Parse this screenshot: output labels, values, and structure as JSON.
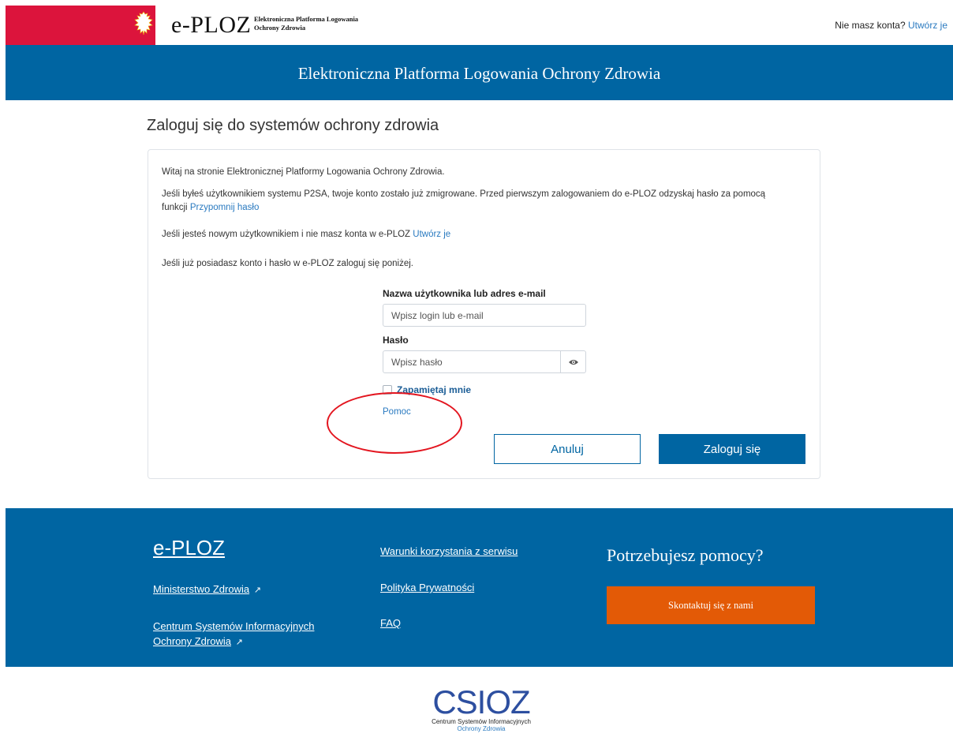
{
  "header": {
    "logo_text": "e-PLOZ",
    "logo_sub_line1": "Elektroniczna Platforma Logowania",
    "logo_sub_line2": "Ochrony Zdrowia",
    "no_account_text": "Nie masz konta?",
    "create_link": "Utwórz je"
  },
  "hero": {
    "title": "Elektroniczna Platforma Logowania Ochrony Zdrowia"
  },
  "page": {
    "title": "Zaloguj się do systemów ochrony zdrowia"
  },
  "card": {
    "welcome": "Witaj na stronie Elektronicznej Platformy Logowania Ochrony Zdrowia.",
    "migrated_text": "Jeśli byłeś użytkownikiem systemu P2SA, twoje konto zostało już zmigrowane. Przed pierwszym zalogowaniem do e-PLOZ odzyskaj hasło za pomocą",
    "migrated_text2": "funkcji",
    "reset_link": "Przypomnij hasło",
    "new_user_text": "Jeśli jesteś nowym użytkownikiem i nie masz konta w e-PLOZ",
    "new_user_link": "Utwórz je",
    "existing_text": "Jeśli już posiadasz konto i hasło w e-PLOZ zaloguj się poniżej."
  },
  "form": {
    "username_label": "Nazwa użytkownika lub adres e-mail",
    "username_placeholder": "Wpisz login lub e-mail",
    "password_label": "Hasło",
    "password_placeholder": "Wpisz hasło",
    "remember_label": "Zapamiętaj mnie",
    "help_link": "Pomoc",
    "cancel_button": "Anuluj",
    "login_button": "Zaloguj się"
  },
  "footer": {
    "brand": "e-PLOZ",
    "ministry_link": "Ministerstwo Zdrowia",
    "csioz_link_line1": "Centrum Systemów Informacyjnych",
    "csioz_link_line2": "Ochrony Zdrowia",
    "terms_link": "Warunki korzystania z serwisu",
    "privacy_link": "Polityka Prywatności",
    "faq_link": "FAQ",
    "help_title": "Potrzebujesz pomocy?",
    "contact_button": "Skontaktuj się z nami"
  },
  "bottom_logo": {
    "mark": "CSIOZ",
    "line1": "Centrum Systemów Informacyjnych",
    "line2": "Ochrony Zdrowia"
  },
  "colors": {
    "brand_blue": "#0065a2",
    "flag_red": "#dc143c",
    "contact_orange": "#e35a06",
    "annotation_red": "#e3151f"
  }
}
